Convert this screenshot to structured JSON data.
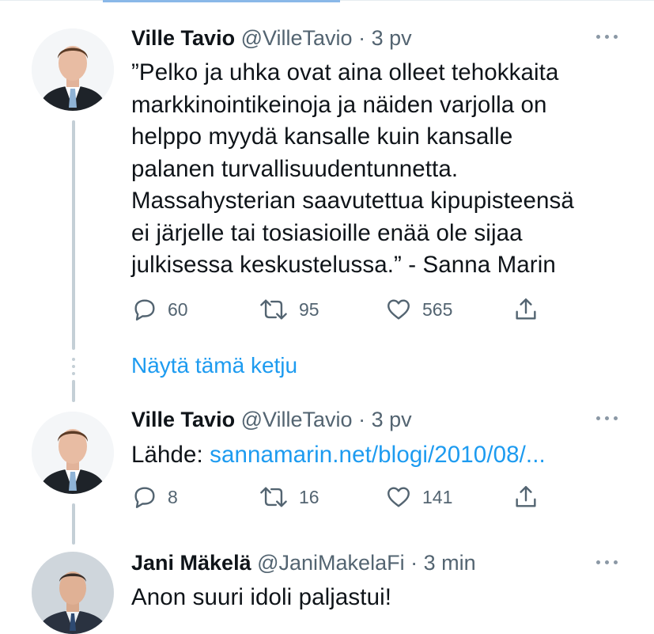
{
  "tweets": [
    {
      "name": "Ville Tavio",
      "handle": "@VilleTavio",
      "time": "· 3 pv",
      "text": "”Pelko ja uhka ovat aina olleet tehokkaita\nmarkkinointikeinoja ja näiden varjolla on\nhelppo myydä kansalle kuin kansalle\npalanen turvallisuudentunnetta.\nMassahysterian saavutettua kipupisteensä\nei järjelle tai tosiasioille enää ole sijaa\njulkisessa keskustelussa.” - Sanna Marin",
      "replies": "60",
      "retweets": "95",
      "likes": "565"
    },
    {
      "name": "Ville Tavio",
      "handle": "@VilleTavio",
      "time": "· 3 pv",
      "text_prefix": "Lähde: ",
      "link": "sannamarin.net/blogi/2010/08/...",
      "replies": "8",
      "retweets": "16",
      "likes": "141"
    },
    {
      "name": "Jani Mäkelä",
      "handle": "@JaniMakelaFi",
      "time": "· 3 min",
      "text": "Anon suuri idoli paljastui!"
    }
  ],
  "show_thread": "Näytä tämä ketju",
  "icons": {
    "reply": "reply-icon",
    "retweet": "retweet-icon",
    "like": "heart-icon",
    "share": "share-icon",
    "more": "more-icon"
  },
  "colors": {
    "link": "#1d9bf0",
    "secondary": "#536471",
    "thread_line": "#c4cfd6"
  }
}
